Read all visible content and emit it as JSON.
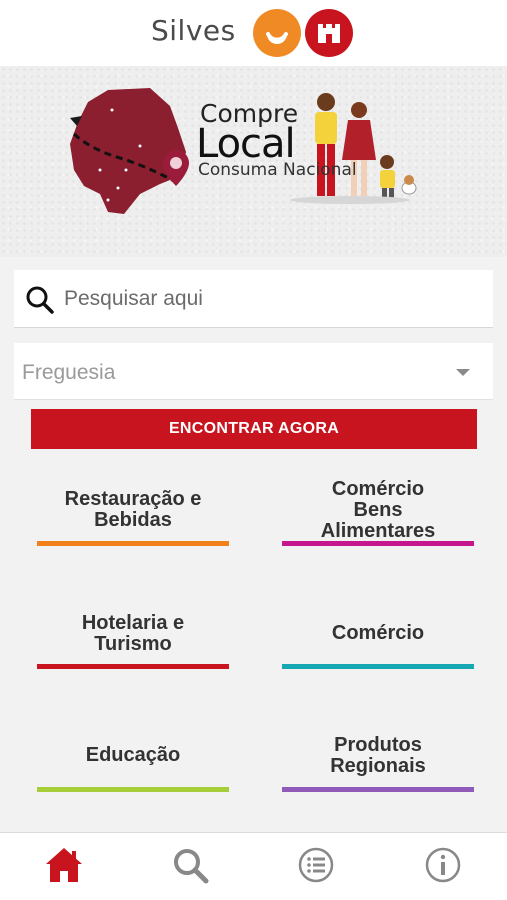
{
  "header": {
    "brand": "Silves",
    "colors": {
      "orange": "#f08a24",
      "red": "#c8141e"
    },
    "icons": [
      "crescent-logo-icon",
      "castle-logo-icon"
    ]
  },
  "banner": {
    "line1": "Compre",
    "line2": "Local",
    "line3": "Consuma Nacional",
    "icons": [
      "map-icon",
      "location-pin-icon",
      "family-illustration",
      "dog-illustration"
    ]
  },
  "search": {
    "placeholder": "Pesquisar aqui"
  },
  "filter": {
    "selected": "Freguesia"
  },
  "cta": {
    "label": "ENCONTRAR AGORA",
    "color": "#c8141e"
  },
  "categories": [
    {
      "label": "Restauração e\nBebidas",
      "color": "#f07f1c"
    },
    {
      "label": "Comércio\nBens\nAlimentares",
      "color": "#c6168d"
    },
    {
      "label": "Hotelaria e\nTurismo",
      "color": "#c8141e"
    },
    {
      "label": "Comércio",
      "color": "#16a8b5"
    },
    {
      "label": "Educação",
      "color": "#a6ce39"
    },
    {
      "label": "Produtos\nRegionais",
      "color": "#8f5ab8"
    }
  ],
  "nav": {
    "items": [
      {
        "icon": "home-icon",
        "active": true,
        "color": "#c8141e"
      },
      {
        "icon": "search-icon",
        "active": false,
        "color": "#888888"
      },
      {
        "icon": "list-icon",
        "active": false,
        "color": "#888888"
      },
      {
        "icon": "info-icon",
        "active": false,
        "color": "#888888"
      }
    ]
  }
}
